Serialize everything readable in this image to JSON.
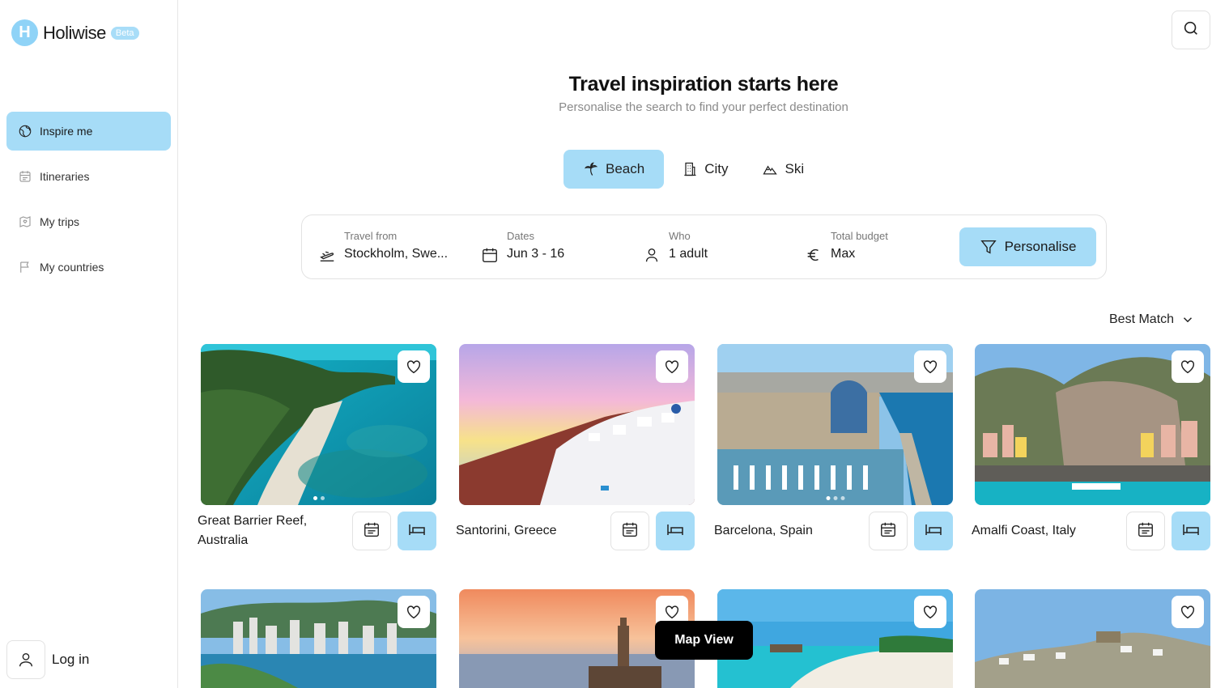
{
  "brand": {
    "name": "Holiwise",
    "badge": "Beta",
    "mark": "H"
  },
  "sidebar": {
    "items": [
      {
        "label": "Inspire me",
        "icon": "globe-icon",
        "active": true
      },
      {
        "label": "Itineraries",
        "icon": "calendar-icon",
        "active": false
      },
      {
        "label": "My trips",
        "icon": "heart-map-icon",
        "active": false
      },
      {
        "label": "My countries",
        "icon": "flag-icon",
        "active": false
      }
    ],
    "login_label": "Log in"
  },
  "header": {
    "title": "Travel inspiration starts here",
    "subtitle": "Personalise the search to find your perfect destination"
  },
  "categories": [
    {
      "label": "Beach",
      "icon": "palm-tree-icon",
      "active": true
    },
    {
      "label": "City",
      "icon": "building-icon",
      "active": false
    },
    {
      "label": "Ski",
      "icon": "mountain-icon",
      "active": false
    }
  ],
  "search": {
    "from": {
      "label": "Travel from",
      "value": "Stockholm, Swe..."
    },
    "dates": {
      "label": "Dates",
      "value": "Jun 3 - 16"
    },
    "who": {
      "label": "Who",
      "value": "1 adult"
    },
    "budget": {
      "label": "Total budget",
      "value": "Max"
    },
    "personalise_label": "Personalise"
  },
  "sort": {
    "label": "Best Match"
  },
  "destinations": [
    {
      "name": "Great Barrier Reef, Australia"
    },
    {
      "name": "Santorini, Greece"
    },
    {
      "name": "Barcelona, Spain"
    },
    {
      "name": "Amalfi Coast, Italy"
    }
  ],
  "map_view_label": "Map View",
  "colors": {
    "accent": "#a6dcf7",
    "brand": "#8fd3f7"
  }
}
